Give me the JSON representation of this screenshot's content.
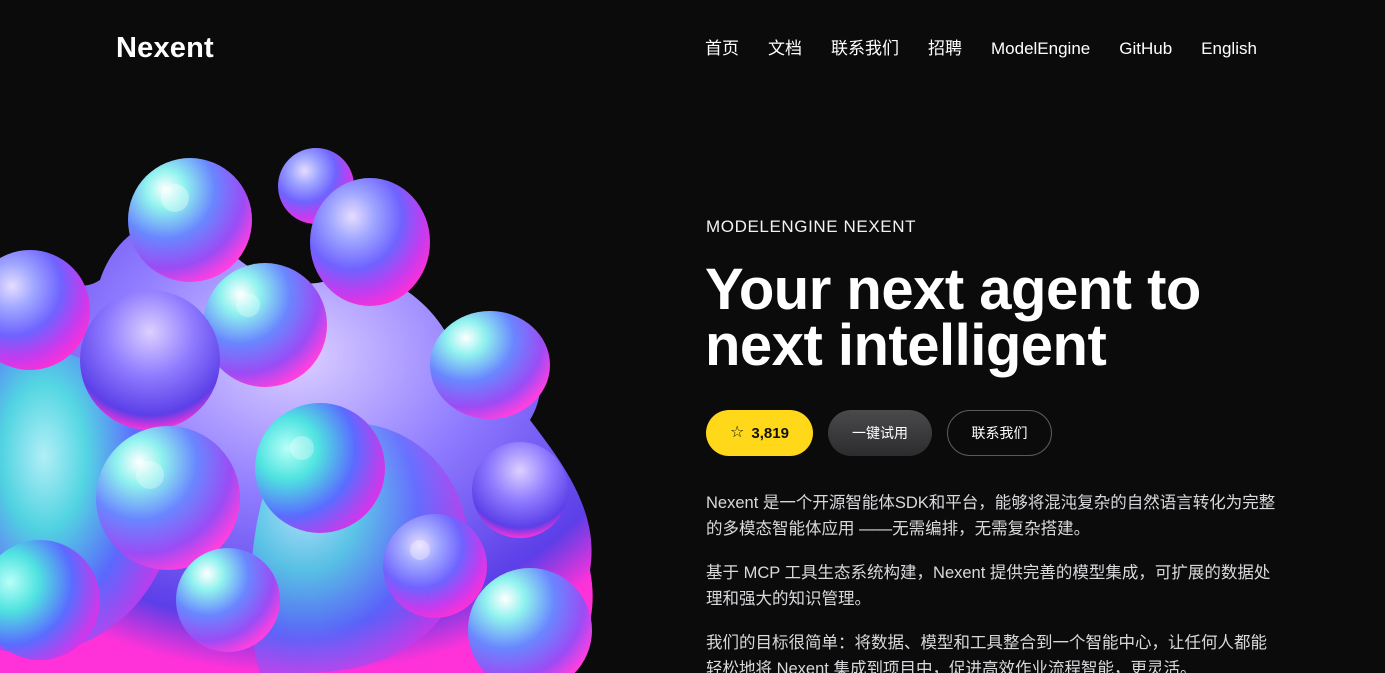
{
  "header": {
    "logo": "Nexent",
    "nav": [
      "首页",
      "文档",
      "联系我们",
      "招聘",
      "ModelEngine",
      "GitHub",
      "English"
    ]
  },
  "hero": {
    "eyebrow": "MODELENGINE NEXENT",
    "headline_line1": "Your next agent to",
    "headline_line2": "next intelligent",
    "star_icon": "star-icon",
    "star_count": "3,819",
    "try_label": "一键试用",
    "contact_label": "联系我们",
    "paragraphs": [
      "Nexent 是一个开源智能体SDK和平台，能够将混沌复杂的自然语言转化为完整的多模态智能体应用 ——无需编排，无需复杂搭建。",
      "基于 MCP 工具生态系统构建，Nexent 提供完善的模型集成，可扩展的数据处理和强大的知识管理。",
      "我们的目标很简单：将数据、模型和工具整合到一个智能中心，让任何人都能轻松地将 Nexent 集成到项目中，促进高效作业流程智能，更灵活。"
    ]
  },
  "colors": {
    "background": "#0b0b0c",
    "star_button": "#ffd81a",
    "blob_cyan": "#4fe3e0",
    "blob_blue": "#5a6cff",
    "blob_magenta": "#ff2fd6"
  }
}
